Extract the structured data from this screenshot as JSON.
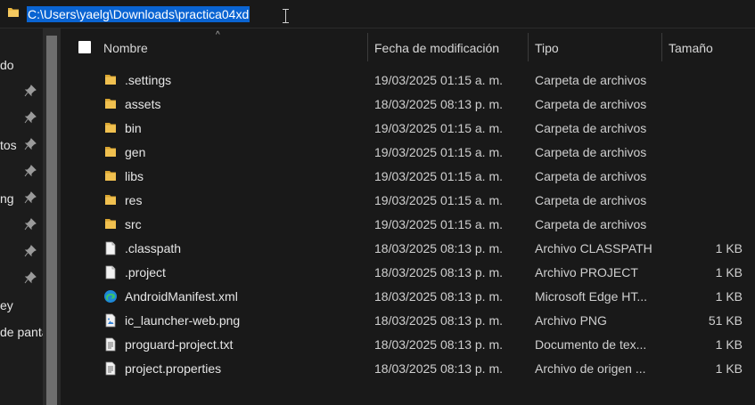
{
  "address_bar": {
    "path": "C:\\Users\\yaelg\\Downloads\\practica04xd"
  },
  "nav_pane": {
    "items": [
      {
        "label": "do"
      },
      {
        "label": "tos"
      },
      {
        "label": "ng"
      },
      {
        "label": "ey"
      },
      {
        "label": "de pantalla"
      }
    ]
  },
  "columns": {
    "name": "Nombre",
    "date": "Fecha de modificación",
    "type": "Tipo",
    "size": "Tamaño"
  },
  "files": [
    {
      "name": ".settings",
      "date": "19/03/2025 01:15 a. m.",
      "type": "Carpeta de archivos",
      "size": "",
      "icon": "folder-icon"
    },
    {
      "name": "assets",
      "date": "18/03/2025 08:13 p. m.",
      "type": "Carpeta de archivos",
      "size": "",
      "icon": "folder-icon"
    },
    {
      "name": "bin",
      "date": "19/03/2025 01:15 a. m.",
      "type": "Carpeta de archivos",
      "size": "",
      "icon": "folder-icon"
    },
    {
      "name": "gen",
      "date": "19/03/2025 01:15 a. m.",
      "type": "Carpeta de archivos",
      "size": "",
      "icon": "folder-icon"
    },
    {
      "name": "libs",
      "date": "19/03/2025 01:15 a. m.",
      "type": "Carpeta de archivos",
      "size": "",
      "icon": "folder-icon"
    },
    {
      "name": "res",
      "date": "19/03/2025 01:15 a. m.",
      "type": "Carpeta de archivos",
      "size": "",
      "icon": "folder-icon"
    },
    {
      "name": "src",
      "date": "19/03/2025 01:15 a. m.",
      "type": "Carpeta de archivos",
      "size": "",
      "icon": "folder-icon"
    },
    {
      "name": ".classpath",
      "date": "18/03/2025 08:13 p. m.",
      "type": "Archivo CLASSPATH",
      "size": "1 KB",
      "icon": "file-icon"
    },
    {
      "name": ".project",
      "date": "18/03/2025 08:13 p. m.",
      "type": "Archivo PROJECT",
      "size": "1 KB",
      "icon": "file-icon"
    },
    {
      "name": "AndroidManifest.xml",
      "date": "18/03/2025 08:13 p. m.",
      "type": "Microsoft Edge HT...",
      "size": "1 KB",
      "icon": "edge-icon"
    },
    {
      "name": "ic_launcher-web.png",
      "date": "18/03/2025 08:13 p. m.",
      "type": "Archivo PNG",
      "size": "51 KB",
      "icon": "image-file-icon"
    },
    {
      "name": "proguard-project.txt",
      "date": "18/03/2025 08:13 p. m.",
      "type": "Documento de tex...",
      "size": "1 KB",
      "icon": "text-file-icon"
    },
    {
      "name": "project.properties",
      "date": "18/03/2025 08:13 p. m.",
      "type": "Archivo de origen ...",
      "size": "1 KB",
      "icon": "text-file-icon"
    }
  ],
  "colors": {
    "selection": "#0a64d2",
    "folder": "#e8b43c",
    "background": "#191919"
  }
}
